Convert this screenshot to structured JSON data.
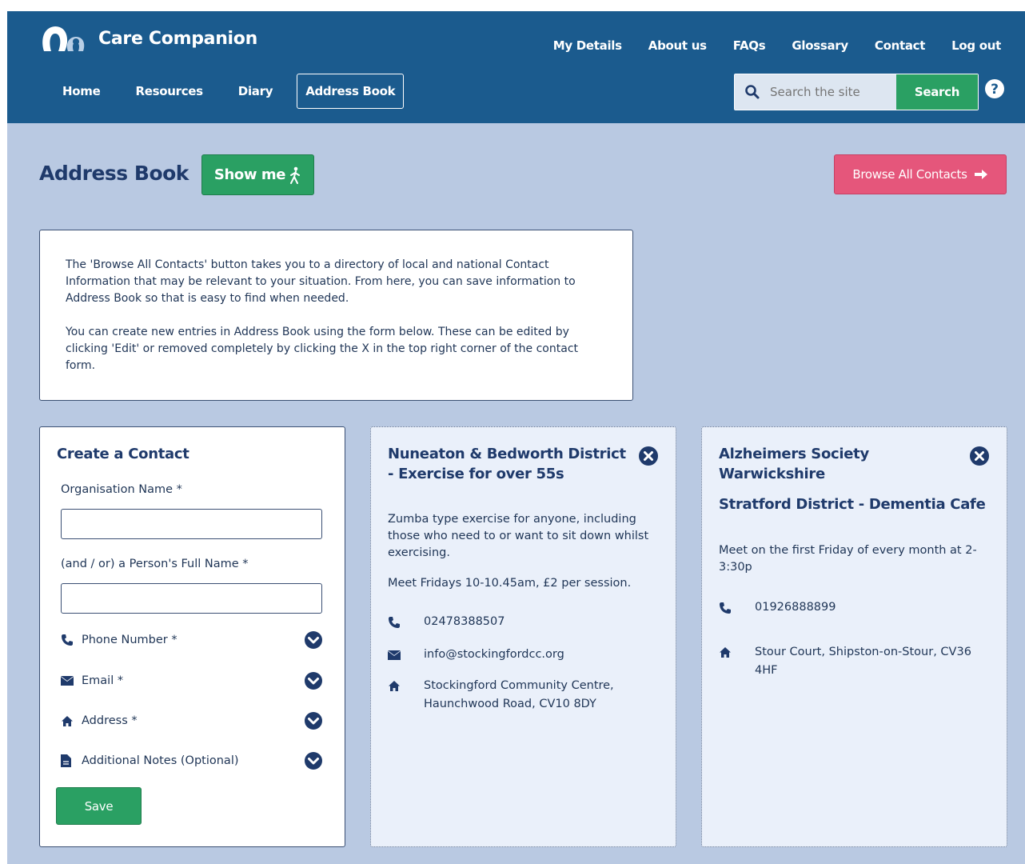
{
  "header": {
    "brand": "Care Companion",
    "top_nav": [
      "My Details",
      "About us",
      "FAQs",
      "Glossary",
      "Contact",
      "Log out"
    ],
    "main_nav": [
      "Home",
      "Resources",
      "Diary",
      "Address Book"
    ],
    "active_main_nav": "Address Book",
    "search": {
      "placeholder": "Search the site",
      "button": "Search"
    }
  },
  "page": {
    "title": "Address Book",
    "show_me": "Show me",
    "browse_all": "Browse All Contacts",
    "info_p1": "The 'Browse All Contacts' button takes you to a directory of local and national Contact Information that may be relevant to your situation. From here, you can save information to Address Book so that is easy to find when needed.",
    "info_p2": "You can create new entries in Address Book using the form below. These can be edited by clicking 'Edit' or removed completely by clicking the X in the top right corner of the contact form."
  },
  "form": {
    "title": "Create a Contact",
    "org_label": "Organisation Name *",
    "org_value": "",
    "person_label": "(and / or) a Person's Full Name *",
    "person_value": "",
    "phone_label": "Phone Number *",
    "email_label": "Email *",
    "address_label": "Address *",
    "notes_label": "Additional Notes (Optional)",
    "save": "Save"
  },
  "contacts": [
    {
      "title": "Nuneaton & Bedworth District - Exercise for over 55s",
      "subtitle": "",
      "desc1": "Zumba type exercise for anyone, including those who need to or want to sit down whilst exercising.",
      "desc2": "Meet Fridays 10-10.45am, £2 per session.",
      "phone": "02478388507",
      "email": "info@stockingfordcc.org",
      "address": "Stockingford Community Centre, Haunchwood Road, CV10 8DY"
    },
    {
      "title": "Alzheimers Society Warwickshire",
      "subtitle": "Stratford District - Dementia Cafe",
      "desc1": "Meet on the first Friday of every month at 2-3:30p",
      "phone": "01926888899",
      "address": "Stour Court, Shipston-on-Stour, CV36 4HF"
    }
  ],
  "colors": {
    "header_bg": "#1b5b8e",
    "page_bg": "#b9c9e2",
    "green": "#2aa063",
    "pink": "#e5567b",
    "navy": "#1f3a6b"
  },
  "icons": [
    "logo-icon",
    "search-icon",
    "help-icon",
    "walking-person-icon",
    "arrow-right-icon",
    "phone-icon",
    "envelope-icon",
    "home-icon",
    "document-icon",
    "chevron-down-icon",
    "close-icon"
  ]
}
